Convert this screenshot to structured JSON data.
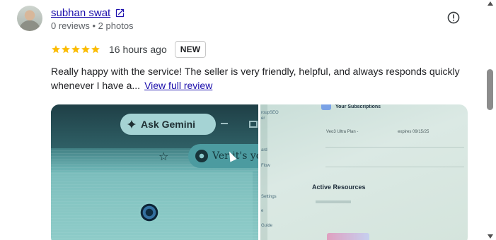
{
  "review": {
    "author": "subhan swat",
    "meta": "0 reviews • 2 photos",
    "rating": 5,
    "rating_max": 5,
    "star_color": "#fbbc04",
    "time_ago": "16 hours ago",
    "badge": "NEW",
    "text": "Really happy with the service! The seller is very friendly, helpful, and always responds quickly whenever I have a...",
    "view_full_label": "View full review",
    "link_color": "#1a0dab"
  },
  "photos": [
    {
      "ask_button": "Ask Gemini",
      "pill_text": "Ver it's yo"
    },
    {
      "header": "Your Subscriptions",
      "side_labels": [
        "roupSEO",
        "er",
        "ard",
        "Flow",
        "Settings",
        "e",
        "Guide"
      ],
      "row_label": "Veo3 Ultra Plan -",
      "row_expires": "expires 09/15/25",
      "section_title": "Active Resources"
    }
  ]
}
